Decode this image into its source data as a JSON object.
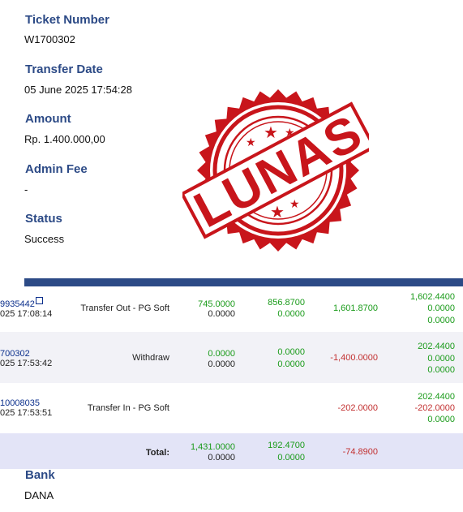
{
  "fields": {
    "ticket": {
      "label": "Ticket Number",
      "value": "W1700302"
    },
    "transfer_date": {
      "label": "Transfer Date",
      "value": "05 June 2025 17:54:28"
    },
    "amount": {
      "label": "Amount",
      "value": "Rp. 1.400.000,00"
    },
    "admin_fee": {
      "label": "Admin Fee",
      "value": "-"
    },
    "status": {
      "label": "Status",
      "value": "Success"
    },
    "bank": {
      "label": "Bank",
      "value": "DANA"
    }
  },
  "stamp": {
    "text": "LUNAS",
    "color": "#c8151b"
  },
  "rows": [
    {
      "ref": "9935442",
      "time": "025 17:08:14",
      "desc": "Transfer Out - PG Soft",
      "c1": [
        "745.0000",
        "0.0000"
      ],
      "c2": [
        "856.8700",
        "0.0000"
      ],
      "c3": "1,601.8700",
      "c4": [
        "1,602.4400",
        "0.0000",
        "0.0000"
      ]
    },
    {
      "ref": "700302",
      "time": "025 17:53:42",
      "desc": "Withdraw",
      "c1": [
        "0.0000",
        "0.0000"
      ],
      "c2": [
        "0.0000",
        "0.0000"
      ],
      "c3": "-1,400.0000",
      "c4": [
        "202.4400",
        "0.0000",
        "0.0000"
      ]
    },
    {
      "ref": "10008035",
      "time": "025 17:53:51",
      "desc": "Transfer In - PG Soft",
      "c3": "-202.0000",
      "c4": [
        "202.4400",
        "-202.0000",
        "0.0000"
      ]
    }
  ],
  "total": {
    "label": "Total:",
    "c1": [
      "1,431.0000",
      "0.0000"
    ],
    "c2": [
      "192.4700",
      "0.0000"
    ],
    "c3": "-74.8900"
  }
}
